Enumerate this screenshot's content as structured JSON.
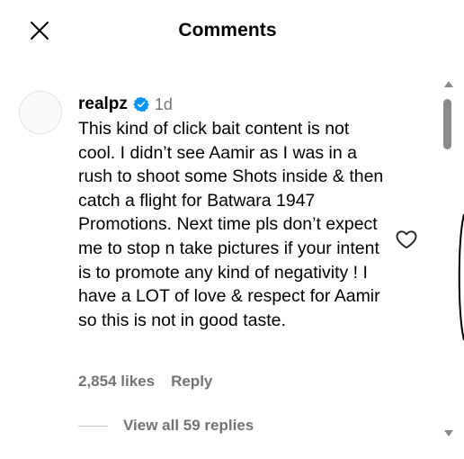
{
  "header": {
    "title": "Comments",
    "close_icon": "close-icon"
  },
  "comment": {
    "username": "realpz",
    "verified_icon": "verified-badge-icon",
    "verified_color": "#0095f6",
    "time": "1d",
    "text": "This kind of click bait content is not cool. I didn’t see Aamir as I was in a rush to shoot some Shots inside & then catch a flight for Batwara 1947 Promotions. Next time pls don’t expect me to stop n take pictures if your intent is to promote any kind of negativity ! I have a LOT of love & respect for Aamir so this is not in good taste.",
    "likes": "2,854 likes",
    "reply_label": "Reply",
    "like_icon": "heart-outline-icon",
    "view_replies_label": "View all 59 replies"
  },
  "colors": {
    "secondary_text": "#737373",
    "scrollbar": "#8a8a8a"
  }
}
